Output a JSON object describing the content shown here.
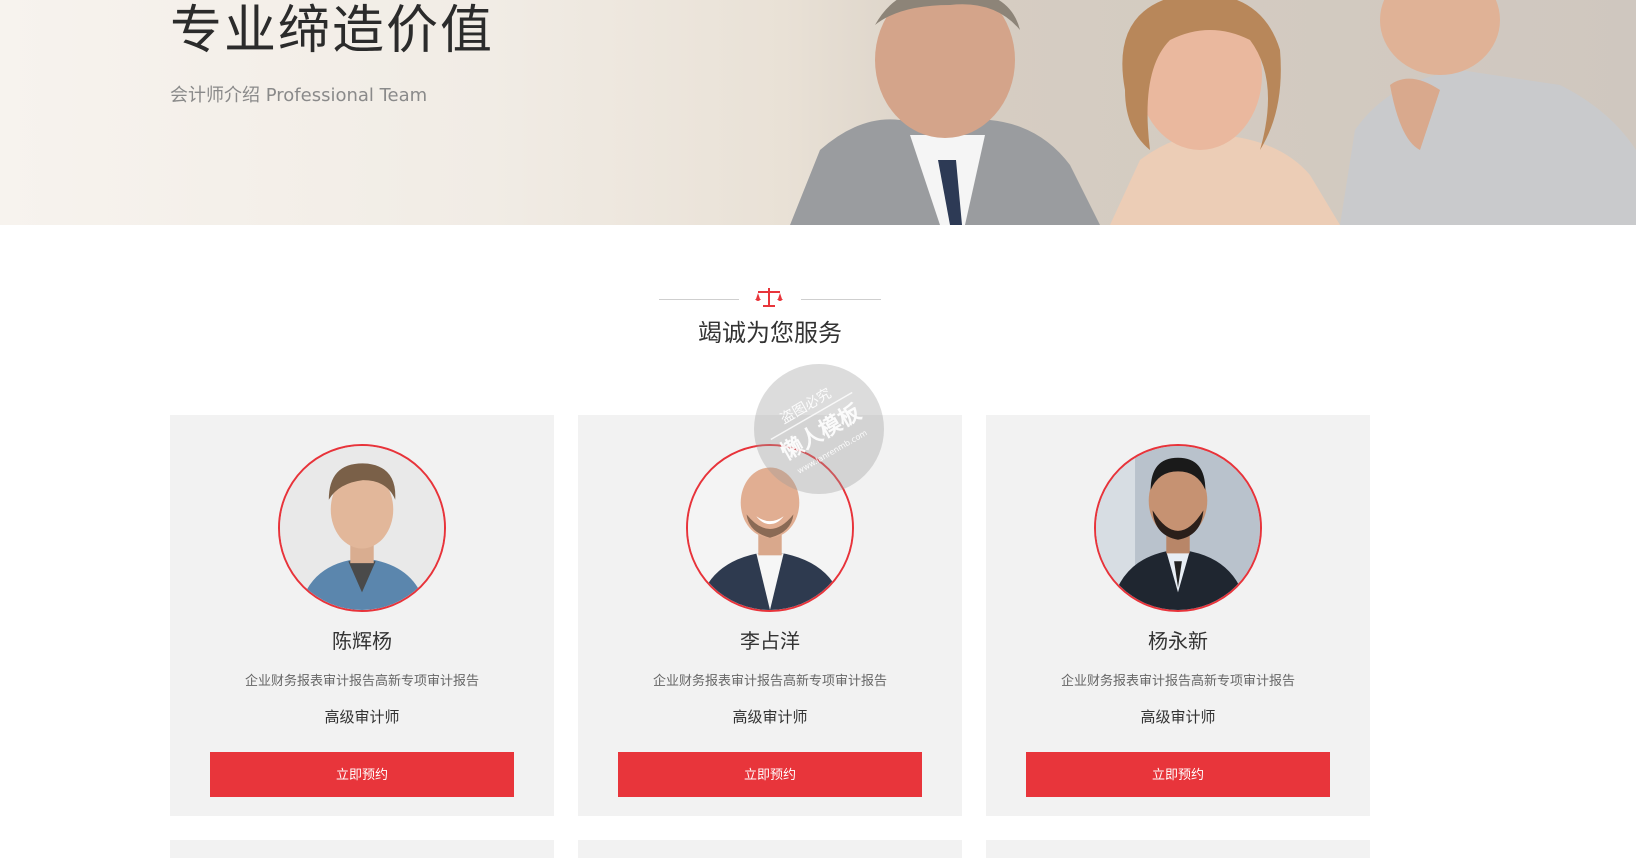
{
  "banner": {
    "title": "专业缔造价值",
    "subtitle": "会计师介绍 Professional Team"
  },
  "section": {
    "title": "竭诚为您服务",
    "icon": "scales-icon"
  },
  "watermark": {
    "line1": "盗图必究",
    "line2": "懒人模板",
    "line3": "www.lanrenmb.com"
  },
  "team": [
    {
      "name": "陈辉杨",
      "desc": "企业财务报表审计报告高新专项审计报告",
      "role": "高级审计师",
      "button": "立即预约"
    },
    {
      "name": "李占洋",
      "desc": "企业财务报表审计报告高新专项审计报告",
      "role": "高级审计师",
      "button": "立即预约"
    },
    {
      "name": "杨永新",
      "desc": "企业财务报表审计报告高新专项审计报告",
      "role": "高级审计师",
      "button": "立即预约"
    }
  ],
  "colors": {
    "accent": "#e8353b",
    "card_bg": "#f2f2f2"
  }
}
